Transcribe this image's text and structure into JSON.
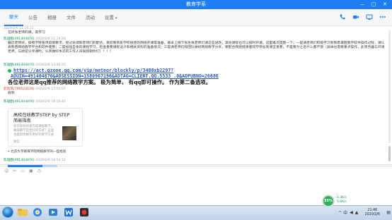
{
  "window": {
    "title": "教育学系",
    "controls": [
      "—",
      "□",
      "✕"
    ]
  },
  "tabs": [
    {
      "label": "聊天",
      "active": true
    },
    {
      "label": "公告"
    },
    {
      "label": "相册"
    },
    {
      "label": "文件"
    },
    {
      "label": "活动"
    },
    {
      "label": "设置",
      "caret": "▾"
    }
  ],
  "toolbar_icons": [
    "phone-icon",
    "video-icon",
    "screen-share-icon",
    "more-icon"
  ],
  "messages": [
    {
      "meta": "2020/2/6 11:16:22",
      "body": "在听张老师的课。高学习"
    },
    {
      "name": "陈雄勤",
      "name_suffix": "(491404870)",
      "meta": "2020/2/6 11:16:26",
      "body_long": "最近老师好，按照学院各项疫情要求，经过协调和老师们的配合，目前教育系学校接连的网络开课等准备，基本上按下张生体老师们课这些进改，其他课程也可以按时开课。这里再次提醒一下。一是请老师们积极学习和熟悉掌握教学软件操作过程，请认真熟悉网络教学平台和软件使用；二是加强自身的课程学习，检查重要课程设计和相关资料的准备情况；三是请老师们和团队做好网络教学分享，要配合网络授课者同学参加到课堂重要，不是要为之后什么都不管（具体也需要重点操作，此项务器与开课老师，与顾名分享课时。认真做好本次的工作人员很感谢你们）！！！"
    },
    {
      "name": "陈雄勤",
      "name_suffix": "(491404870)",
      "meta": "2020/2/6 13:46:25",
      "link_line1": "https://act.qzone.qq.com/vip/meteor/blockly/p/3488xb2297?",
      "link_line2": "ADUIN=491404870&ADSESSION=1580967196&ADTAG=CLIENT.QQ.5533_.0&ADPUBNO=26686",
      "bold": "各位老师这是qq推荐的网络教学方案。 极为简单， 有qq即可操作。 作为第二备选项",
      "bold_suffix": "。"
    },
    {
      "name": "彭凯凤",
      "name_suffix": "(799523128)",
      "meta": "2020/2/6 13:55:07",
      "body": "收到"
    },
    {
      "name": "陈雄勤",
      "name_suffix": "(491404870)",
      "meta": "2020/2/6 18:16:42"
    },
    {
      "card_title": "高校在线教学STEP by STEP简易指南",
      "card_desc": "如何高效快速完成课程教学，确保教学是更好的方式？这里也能帮你解答更好的教学方式",
      "card_source": "微信"
    },
    {
      "body": "北京大学教育学院网络教学的一些经验"
    },
    {
      "name": "陈雄勤",
      "name_suffix": "(491404870)",
      "meta": "2020/2/6 18:54:12",
      "body": "……"
    }
  ],
  "input": {
    "progress_fraction": 0.7,
    "send_label": "发送(S)"
  },
  "taskbar": {
    "battery_label": "35%",
    "net_up": "0.3K/s",
    "net_down": "5.6K/s",
    "tray_text": "^ 中",
    "clock_time": "21:46",
    "clock_date": "2020/2/6"
  }
}
